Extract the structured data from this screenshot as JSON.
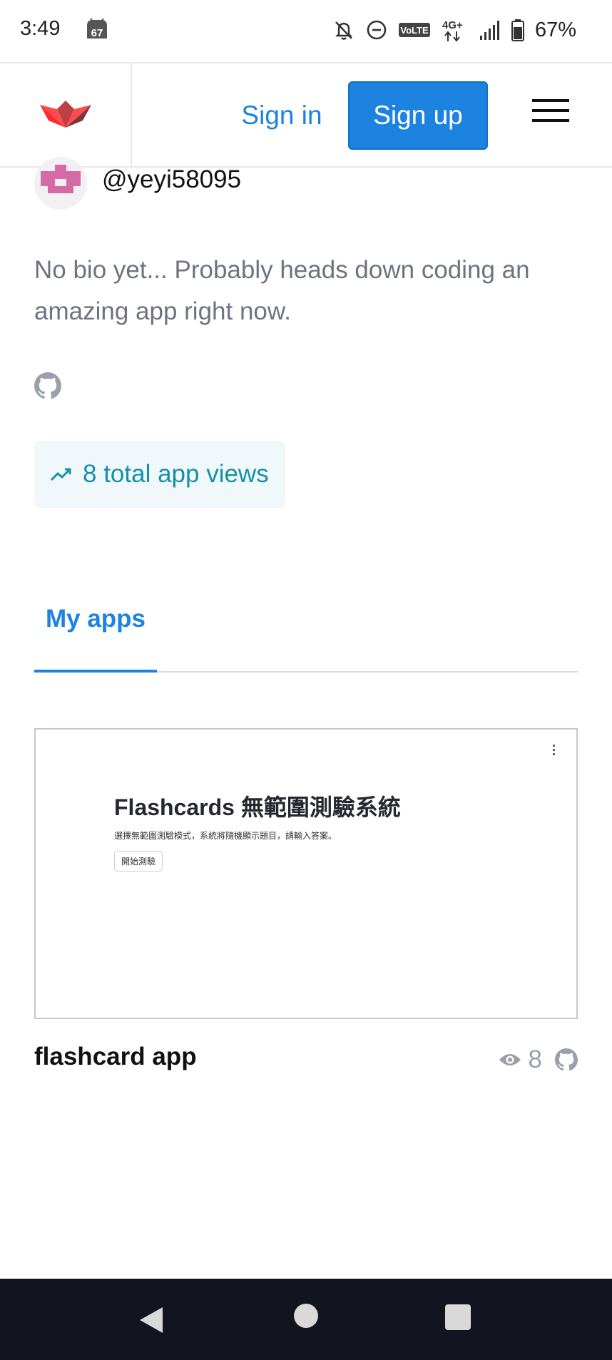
{
  "status_bar": {
    "time": "3:49",
    "notification_badge": "67",
    "network_label": "VoLTE",
    "battery_percent": "67%",
    "icons": [
      "bell-off-icon",
      "do-not-disturb-icon",
      "volte-icon",
      "4g-plus-icon",
      "signal-icon",
      "battery-icon"
    ]
  },
  "header": {
    "logo_icon": "streamlit-crown-icon",
    "sign_in_label": "Sign in",
    "sign_up_label": "Sign up",
    "menu_icon": "hamburger-menu-icon"
  },
  "profile": {
    "username": "@yeyi58095",
    "bio": "No bio yet... Probably heads down coding an amazing app right now.",
    "github_icon": "github-icon",
    "views_text": "8 total app views",
    "views_icon": "trending-up-icon"
  },
  "tabs": [
    {
      "label": "My apps",
      "active": true
    }
  ],
  "apps": [
    {
      "name": "flashcard app",
      "views": "8",
      "thumbnail": {
        "title": "Flashcards 無範圍測驗系統",
        "subtitle": "選擇無範圍測驗模式，系統將隨機顯示題目，請輸入答案。",
        "button_label": "開始測驗"
      }
    }
  ],
  "nav_bar": {
    "icons": [
      "back-icon",
      "home-icon",
      "recents-icon"
    ]
  },
  "colors": {
    "accent": "#1c83e1",
    "views_text": "#1590a6",
    "views_bg": "#f0f8fc",
    "logo_red": "#ff4b4b",
    "nav_bar_bg": "#121520"
  }
}
